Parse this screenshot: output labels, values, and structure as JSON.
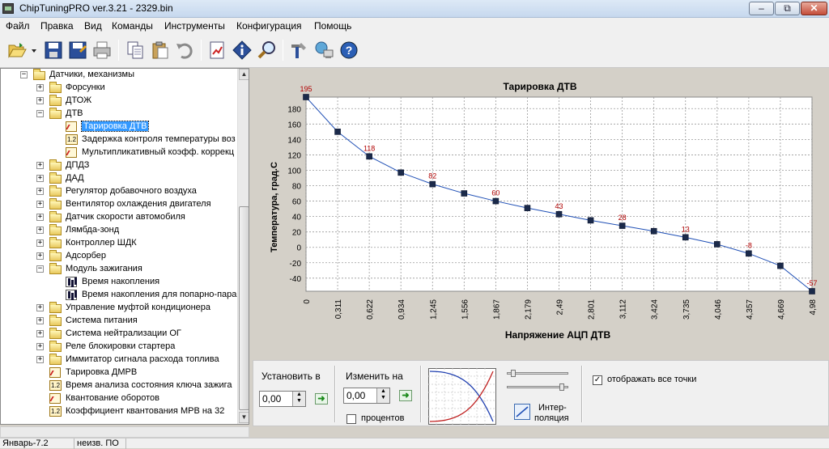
{
  "window": {
    "title": "ChipTuningPRO ver.3.21 - 2329.bin",
    "min_label": "‒",
    "max_label": "⧉",
    "close_label": "✕"
  },
  "menu": [
    {
      "label": "Файл"
    },
    {
      "label": "Правка"
    },
    {
      "label": "Вид"
    },
    {
      "label": "Команды"
    },
    {
      "label": "Инструменты"
    },
    {
      "label": "Конфигурация"
    },
    {
      "label": "Помощь"
    }
  ],
  "toolbar": {
    "icons": [
      "open-folder-icon",
      "dropdown-arrow-icon",
      "save-icon",
      "save-as-icon",
      "print-icon",
      "copy-icon",
      "paste-icon",
      "undo-icon",
      "report-icon",
      "info-icon",
      "search-icon",
      "tools-icon",
      "network-icon",
      "help-icon"
    ]
  },
  "tree": {
    "nodes": [
      {
        "label": "Датчики, механизмы",
        "level": 1,
        "icon": "folder-icon",
        "expander": "−"
      },
      {
        "label": "Форсунки",
        "level": 2,
        "icon": "folder-icon",
        "expander": "+"
      },
      {
        "label": "ДТОЖ",
        "level": 2,
        "icon": "folder-icon",
        "expander": "+"
      },
      {
        "label": "ДТВ",
        "level": 2,
        "icon": "folder-icon",
        "expander": "−"
      },
      {
        "label": "Тарировка ДТВ",
        "level": 3,
        "icon": "graph-icon",
        "expander": "",
        "selected": true
      },
      {
        "label": "Задержка контроля температуры воз",
        "level": 3,
        "icon": "number-icon",
        "expander": ""
      },
      {
        "label": "Мультипликативный коэфф. коррекц",
        "level": 3,
        "icon": "graph-icon",
        "expander": ""
      },
      {
        "label": "ДПДЗ",
        "level": 2,
        "icon": "folder-icon",
        "expander": "+"
      },
      {
        "label": "ДАД",
        "level": 2,
        "icon": "folder-icon",
        "expander": "+"
      },
      {
        "label": "Регулятор добавочного воздуха",
        "level": 2,
        "icon": "folder-icon",
        "expander": "+"
      },
      {
        "label": "Вентилятор охлаждения двигателя",
        "level": 2,
        "icon": "folder-icon",
        "expander": "+"
      },
      {
        "label": "Датчик скорости автомобиля",
        "level": 2,
        "icon": "folder-icon",
        "expander": "+"
      },
      {
        "label": "Лямбда-зонд",
        "level": 2,
        "icon": "folder-icon",
        "expander": "+"
      },
      {
        "label": "Контроллер ШДК",
        "level": 2,
        "icon": "folder-icon",
        "expander": "+"
      },
      {
        "label": "Адсорбер",
        "level": 2,
        "icon": "folder-icon",
        "expander": "+"
      },
      {
        "label": "Модуль зажигания",
        "level": 2,
        "icon": "folder-icon",
        "expander": "−"
      },
      {
        "label": "Время накопления",
        "level": 3,
        "icon": "bars-icon",
        "expander": ""
      },
      {
        "label": "Время накопления для попарно-пара",
        "level": 3,
        "icon": "bars-icon",
        "expander": ""
      },
      {
        "label": "Управление муфтой кондиционера",
        "level": 2,
        "icon": "folder-icon",
        "expander": "+"
      },
      {
        "label": "Система питания",
        "level": 2,
        "icon": "folder-icon",
        "expander": "+"
      },
      {
        "label": "Система нейтрализации ОГ",
        "level": 2,
        "icon": "folder-icon",
        "expander": "+"
      },
      {
        "label": "Реле блокировки стартера",
        "level": 2,
        "icon": "folder-icon",
        "expander": "+"
      },
      {
        "label": "Иммитатор сигнала расхода топлива",
        "level": 2,
        "icon": "folder-icon",
        "expander": "+"
      },
      {
        "label": "Тарировка ДМРВ",
        "level": 2,
        "icon": "graph-icon",
        "expander": ""
      },
      {
        "label": "Время анализа состояния ключа зажига",
        "level": 2,
        "icon": "number-icon",
        "expander": ""
      },
      {
        "label": "Квантование оборотов",
        "level": 2,
        "icon": "graph-icon",
        "expander": ""
      },
      {
        "label": "Коэффициент квантования МРВ на 32",
        "level": 2,
        "icon": "number-icon",
        "expander": ""
      }
    ]
  },
  "chart_data": {
    "type": "line",
    "title": "Тарировка ДТВ",
    "xlabel": "Напряжение АЦП ДТВ",
    "ylabel": "Температура, град.С",
    "x": [
      "0",
      "0,311",
      "0,622",
      "0,934",
      "1,245",
      "1,556",
      "1,867",
      "2,179",
      "2,49",
      "2,801",
      "3,112",
      "3,424",
      "3,735",
      "4,046",
      "4,357",
      "4,669",
      "4,98"
    ],
    "values": [
      195,
      150,
      118,
      97,
      82,
      70,
      60,
      51,
      43,
      35,
      28,
      21,
      13,
      4,
      -8,
      -24,
      -57
    ],
    "point_labels": [
      "195",
      "",
      "118",
      "",
      "82",
      "",
      "60",
      "",
      "43",
      "",
      "28",
      "",
      "13",
      "",
      "-8",
      "",
      "-57"
    ],
    "yticks": [
      "-40",
      "-20",
      "0",
      "20",
      "40",
      "60",
      "80",
      "100",
      "120",
      "140",
      "160",
      "180"
    ],
    "ylim": [
      -57,
      195
    ],
    "grid": true,
    "line_color": "#1f4fb5",
    "marker_color": "#1b2a4a",
    "label_color": "#b00000"
  },
  "controls": {
    "set_label": "Установить в",
    "set_value": "0,00",
    "change_label": "Изменить на",
    "change_value": "0,00",
    "percent_label": "процентов",
    "percent_checked": "",
    "interp_label_1": "Интер-",
    "interp_label_2": "поляция",
    "show_points_label": "отображать все точки",
    "show_points_checked": "✓"
  },
  "status": {
    "cell1": "Январь-7.2",
    "cell2": "неизв. ПО"
  }
}
